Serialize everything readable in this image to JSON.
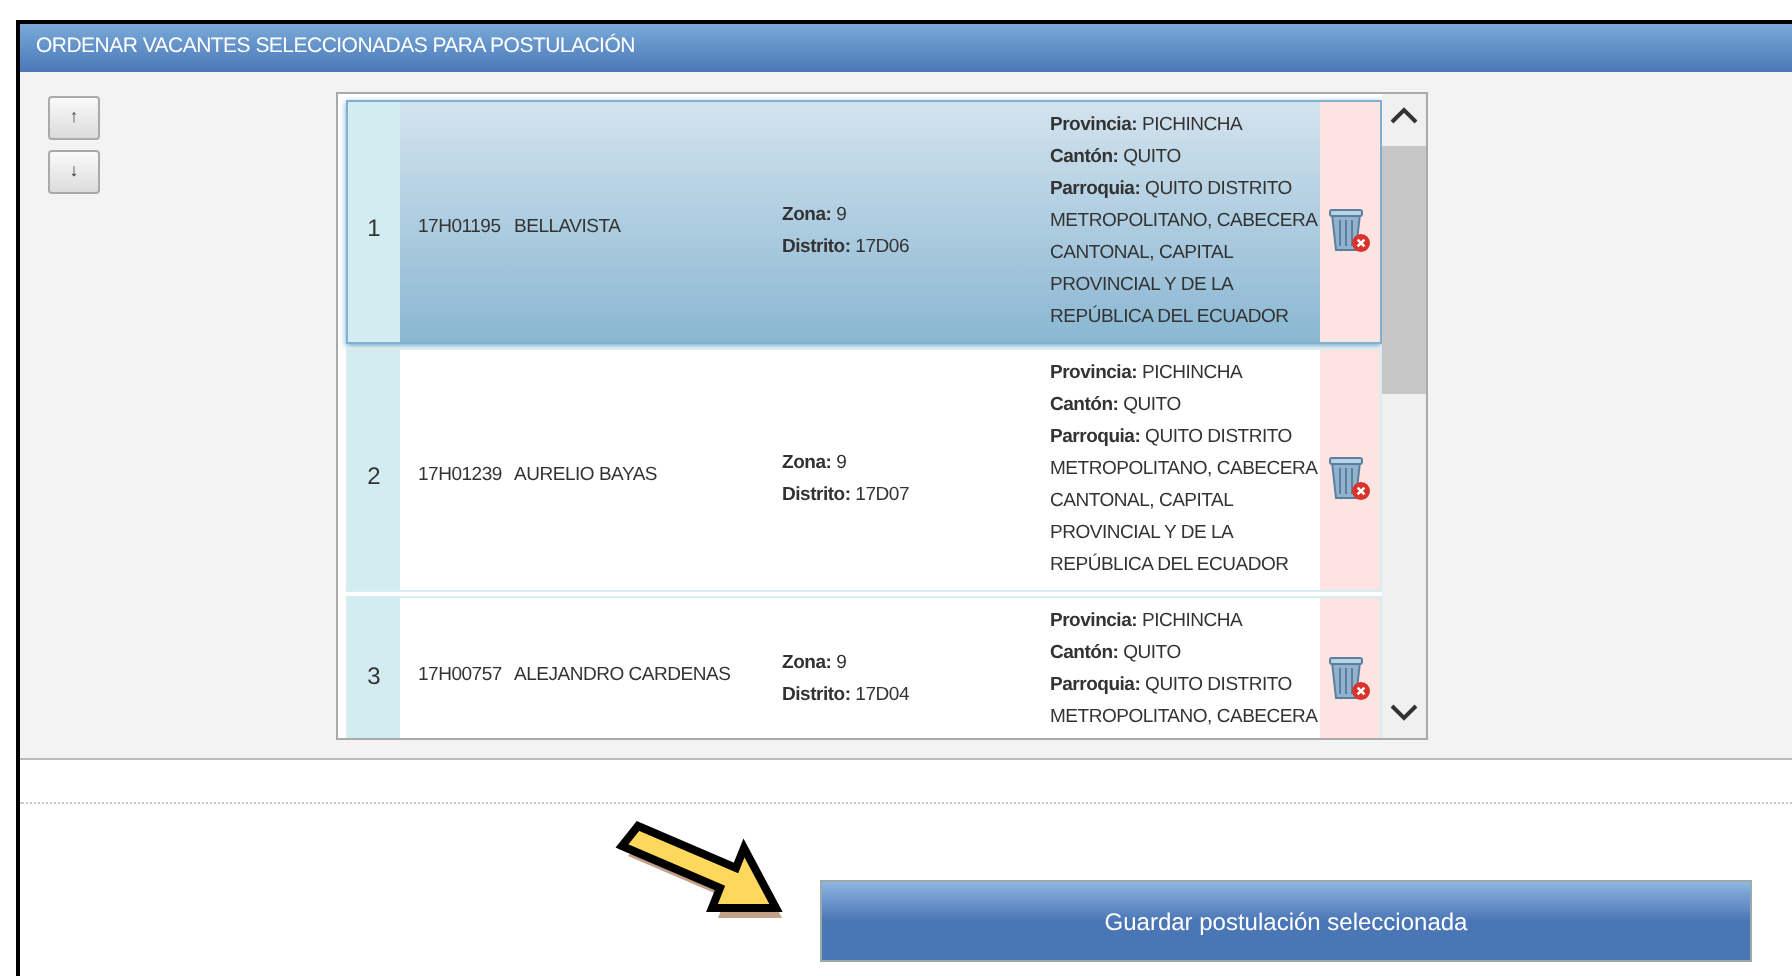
{
  "panel": {
    "title": "ORDENAR VACANTES SELECCIONADAS PARA POSTULACIÓN"
  },
  "order_buttons": [
    {
      "label": "↑"
    },
    {
      "label": "↓"
    }
  ],
  "rows": [
    {
      "number": "1",
      "code": "17H01195",
      "name": "BELLAVISTA",
      "selected": true,
      "zone": [
        {
          "label": "Zona:",
          "value": "9"
        },
        {
          "label": "Distrito:",
          "value": "17D06"
        }
      ],
      "location": [
        {
          "label": "Provincia:",
          "value": "PICHINCHA"
        },
        {
          "label": "Cantón:",
          "value": "QUITO"
        },
        {
          "label": "Parroquia:",
          "value": "QUITO DISTRITO METROPOLITANO, CABECERA CANTONAL, CAPITAL PROVINCIAL Y DE LA REPÚBLICA DEL ECUADOR"
        }
      ]
    },
    {
      "number": "2",
      "code": "17H01239",
      "name": "AURELIO BAYAS",
      "selected": false,
      "zone": [
        {
          "label": "Zona:",
          "value": "9"
        },
        {
          "label": "Distrito:",
          "value": "17D07"
        }
      ],
      "location": [
        {
          "label": "Provincia:",
          "value": "PICHINCHA"
        },
        {
          "label": "Cantón:",
          "value": "QUITO"
        },
        {
          "label": "Parroquia:",
          "value": "QUITO DISTRITO METROPOLITANO, CABECERA CANTONAL, CAPITAL PROVINCIAL Y DE LA REPÚBLICA DEL ECUADOR"
        }
      ]
    },
    {
      "number": "3",
      "code": "17H00757",
      "name": "ALEJANDRO CARDENAS",
      "selected": false,
      "zone": [
        {
          "label": "Zona:",
          "value": "9"
        },
        {
          "label": "Distrito:",
          "value": "17D04"
        }
      ],
      "location": [
        {
          "label": "Provincia:",
          "value": "PICHINCHA"
        },
        {
          "label": "Cantón:",
          "value": "QUITO"
        },
        {
          "label": "Parroquia:",
          "value": "QUITO DISTRITO METROPOLITANO, CABECERA"
        }
      ]
    }
  ],
  "save_button": {
    "label": "Guardar postulación seleccionada"
  }
}
